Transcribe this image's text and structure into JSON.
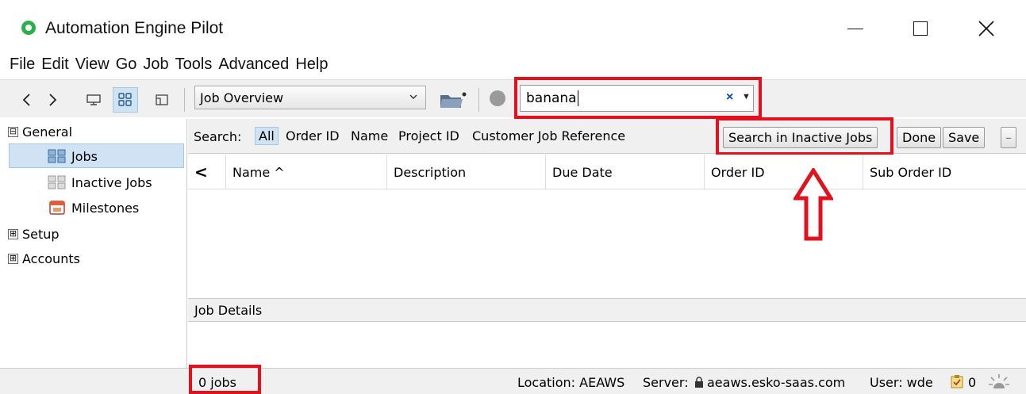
{
  "window": {
    "title": "Automation Engine Pilot"
  },
  "menu": [
    "File",
    "Edit",
    "View",
    "Go",
    "Job",
    "Tools",
    "Advanced",
    "Help"
  ],
  "toolbar": {
    "view_selector": "Job Overview",
    "search_value": "banana"
  },
  "sidebar": {
    "groups": [
      {
        "label": "General",
        "expander": "⊟",
        "items": [
          {
            "label": "Jobs",
            "selected": true
          },
          {
            "label": "Inactive Jobs",
            "selected": false
          },
          {
            "label": "Milestones",
            "selected": false
          }
        ]
      },
      {
        "label": "Setup",
        "expander": "⊞"
      },
      {
        "label": "Accounts",
        "expander": "⊞"
      }
    ]
  },
  "filter": {
    "label": "Search:",
    "options": [
      "All",
      "Order ID",
      "Name",
      "Project ID",
      "Customer Job Reference"
    ],
    "active": "All",
    "buttons": {
      "inactive": "Search in Inactive Jobs",
      "done": "Done",
      "save": "Save",
      "minus": "–"
    }
  },
  "table": {
    "share_icon": "<",
    "columns": [
      "Name ^",
      "Description",
      "Due Date",
      "Order ID",
      "Sub Order ID"
    ]
  },
  "details": {
    "title": "Job Details"
  },
  "status": {
    "count": "0 jobs",
    "location": "Location: AEAWS",
    "server_label": "Server:",
    "server": "aeaws.esko-saas.com",
    "user": "User: wde",
    "tasks": "0"
  },
  "colors": {
    "highlight": "#e3101e",
    "selection": "#cfe3f5",
    "logo": "#2db04a"
  }
}
